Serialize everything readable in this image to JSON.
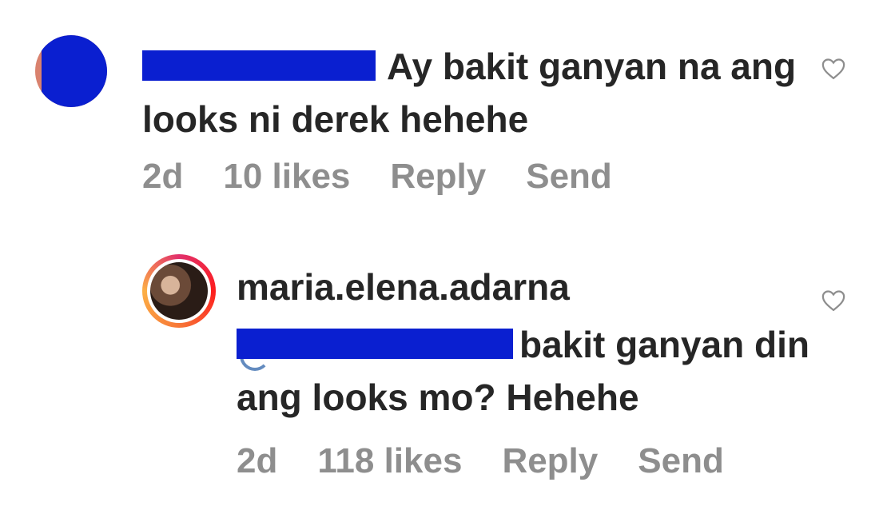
{
  "comments": [
    {
      "username": "",
      "text": "Ay bakit ganyan na ang looks ni derek hehehe",
      "meta": {
        "time": "2d",
        "likes": "10 likes",
        "reply": "Reply",
        "send": "Send"
      },
      "like_icon": "heart-outline-icon"
    },
    {
      "username": "maria.elena.adarna",
      "text": "bakit ganyan din ang looks mo? Hehehe",
      "meta": {
        "time": "2d",
        "likes": "118 likes",
        "reply": "Reply",
        "send": "Send"
      },
      "like_icon": "heart-outline-icon"
    }
  ],
  "colors": {
    "redaction": "#0a1fd0",
    "text": "#262626",
    "meta": "#8e8e8e",
    "story_ring": "#e1306c"
  }
}
